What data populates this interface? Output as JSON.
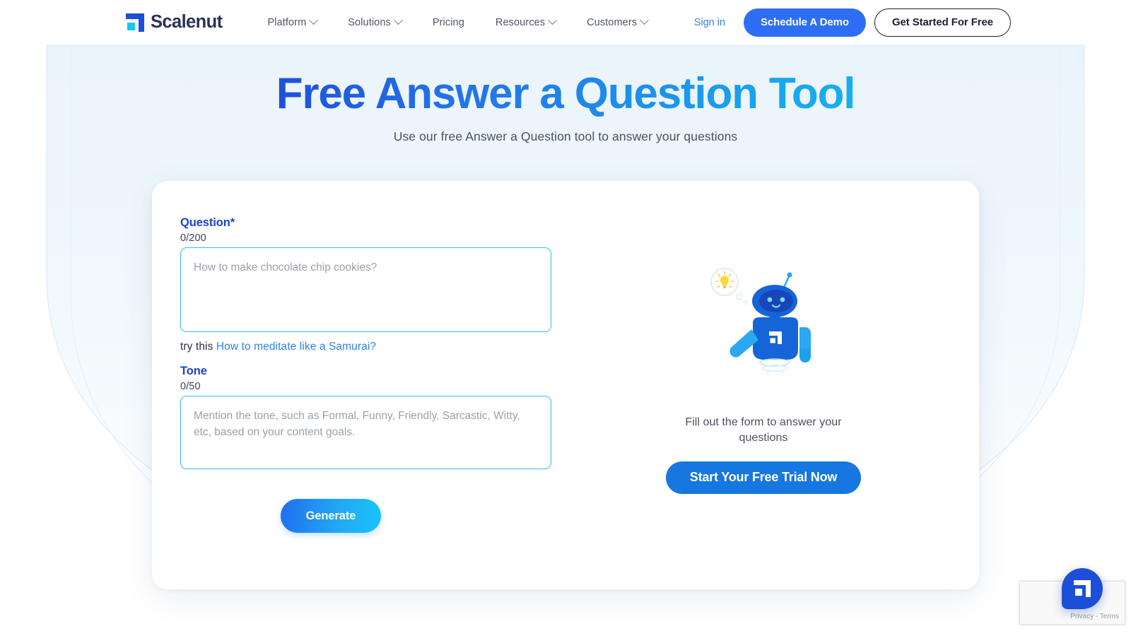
{
  "brand": {
    "name": "Scalenut",
    "logo_icon": "scalenut-logo-icon",
    "accent_blue": "#2d6ef5",
    "accent_cyan": "#35b9f2",
    "dark_navy": "#2a3358"
  },
  "navbar": {
    "links": [
      {
        "label": "Platform",
        "has_dropdown": true
      },
      {
        "label": "Solutions",
        "has_dropdown": true
      },
      {
        "label": "Pricing",
        "has_dropdown": false
      },
      {
        "label": "Resources",
        "has_dropdown": true
      },
      {
        "label": "Customers",
        "has_dropdown": true
      }
    ],
    "signin_label": "Sign in",
    "demo_label": "Schedule A Demo",
    "get_started_label": "Get Started For Free"
  },
  "hero": {
    "title": "Free Answer a Question Tool",
    "subtitle": "Use our free Answer a Question tool to answer your questions"
  },
  "form": {
    "question": {
      "label": "Question*",
      "counter": "0/200",
      "placeholder": "How to make chocolate chip cookies?",
      "value": ""
    },
    "try_this": {
      "prefix": "try this",
      "link_label": "How to meditate like a Samurai?"
    },
    "tone": {
      "label": "Tone",
      "counter": "0/50",
      "placeholder": "Mention the tone, such as Formal, Funny, Friendly, Sarcastic, Witty, etc, based on your content goals.",
      "value": ""
    },
    "generate_label": "Generate"
  },
  "side_panel": {
    "illustration": "robot-mascot-illustration",
    "message": "Fill out the form to answer your questions",
    "cta_label": "Start Your Free Trial Now"
  },
  "widgets": {
    "recaptcha_terms": "Privacy - Terms",
    "chat_icon": "chat-launcher-icon"
  }
}
